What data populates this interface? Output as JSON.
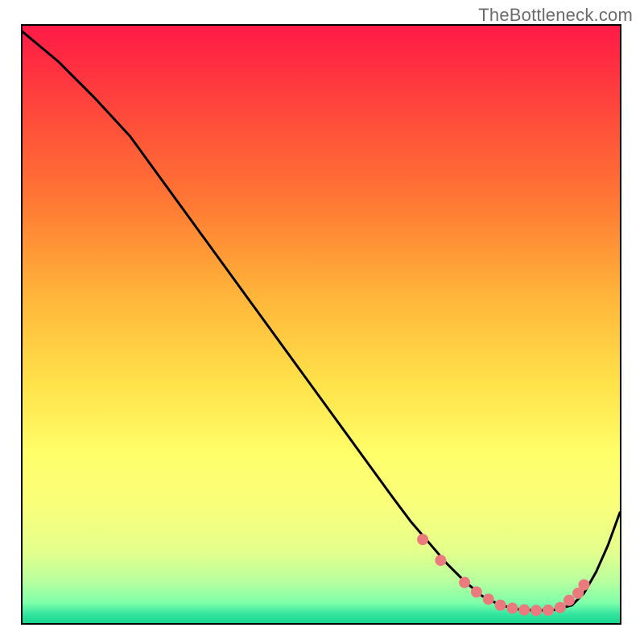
{
  "attribution": "TheBottleneck.com",
  "gradient": {
    "stops": [
      {
        "offset": 0.0,
        "color": "#ff1a46"
      },
      {
        "offset": 0.15,
        "color": "#ff4a3b"
      },
      {
        "offset": 0.3,
        "color": "#ff7a33"
      },
      {
        "offset": 0.45,
        "color": "#ffb43a"
      },
      {
        "offset": 0.6,
        "color": "#ffe24a"
      },
      {
        "offset": 0.72,
        "color": "#ffff6a"
      },
      {
        "offset": 0.8,
        "color": "#faff7a"
      },
      {
        "offset": 0.88,
        "color": "#e4ff8c"
      },
      {
        "offset": 0.93,
        "color": "#b8ff9e"
      },
      {
        "offset": 0.966,
        "color": "#7effa9"
      },
      {
        "offset": 0.985,
        "color": "#35e6a0"
      },
      {
        "offset": 1.0,
        "color": "#17d58f"
      }
    ]
  },
  "chart_data": {
    "type": "line",
    "title": "",
    "xlabel": "",
    "ylabel": "",
    "xrange": [
      0,
      100
    ],
    "yrange": [
      0,
      100
    ],
    "grid": false,
    "legend": false,
    "series": [
      {
        "name": "bottleneck-curve",
        "x": [
          0,
          6,
          12,
          18,
          22,
          26,
          30,
          34,
          38,
          42,
          46,
          50,
          54,
          58,
          62,
          65,
          68,
          71,
          74,
          77,
          80,
          83,
          86,
          89,
          92,
          94,
          96,
          98,
          100
        ],
        "y": [
          99,
          94,
          88,
          81.5,
          76,
          70.5,
          65,
          59.5,
          54,
          48.5,
          43,
          37.5,
          32,
          26.5,
          21,
          17,
          13.5,
          10,
          7,
          4.5,
          3,
          2.3,
          2.1,
          2.2,
          3,
          5,
          8.5,
          13,
          18.5
        ]
      }
    ],
    "markers": {
      "name": "optimal-band-dots",
      "color": "#eb7a7f",
      "radius_px": 7,
      "x": [
        67,
        70,
        74,
        76,
        78,
        80,
        82,
        84,
        86,
        88,
        90,
        91.5,
        93,
        94
      ],
      "y": [
        14,
        10.5,
        6.8,
        5.2,
        4.0,
        3.0,
        2.5,
        2.2,
        2.1,
        2.15,
        2.6,
        3.8,
        5.0,
        6.4
      ]
    }
  }
}
